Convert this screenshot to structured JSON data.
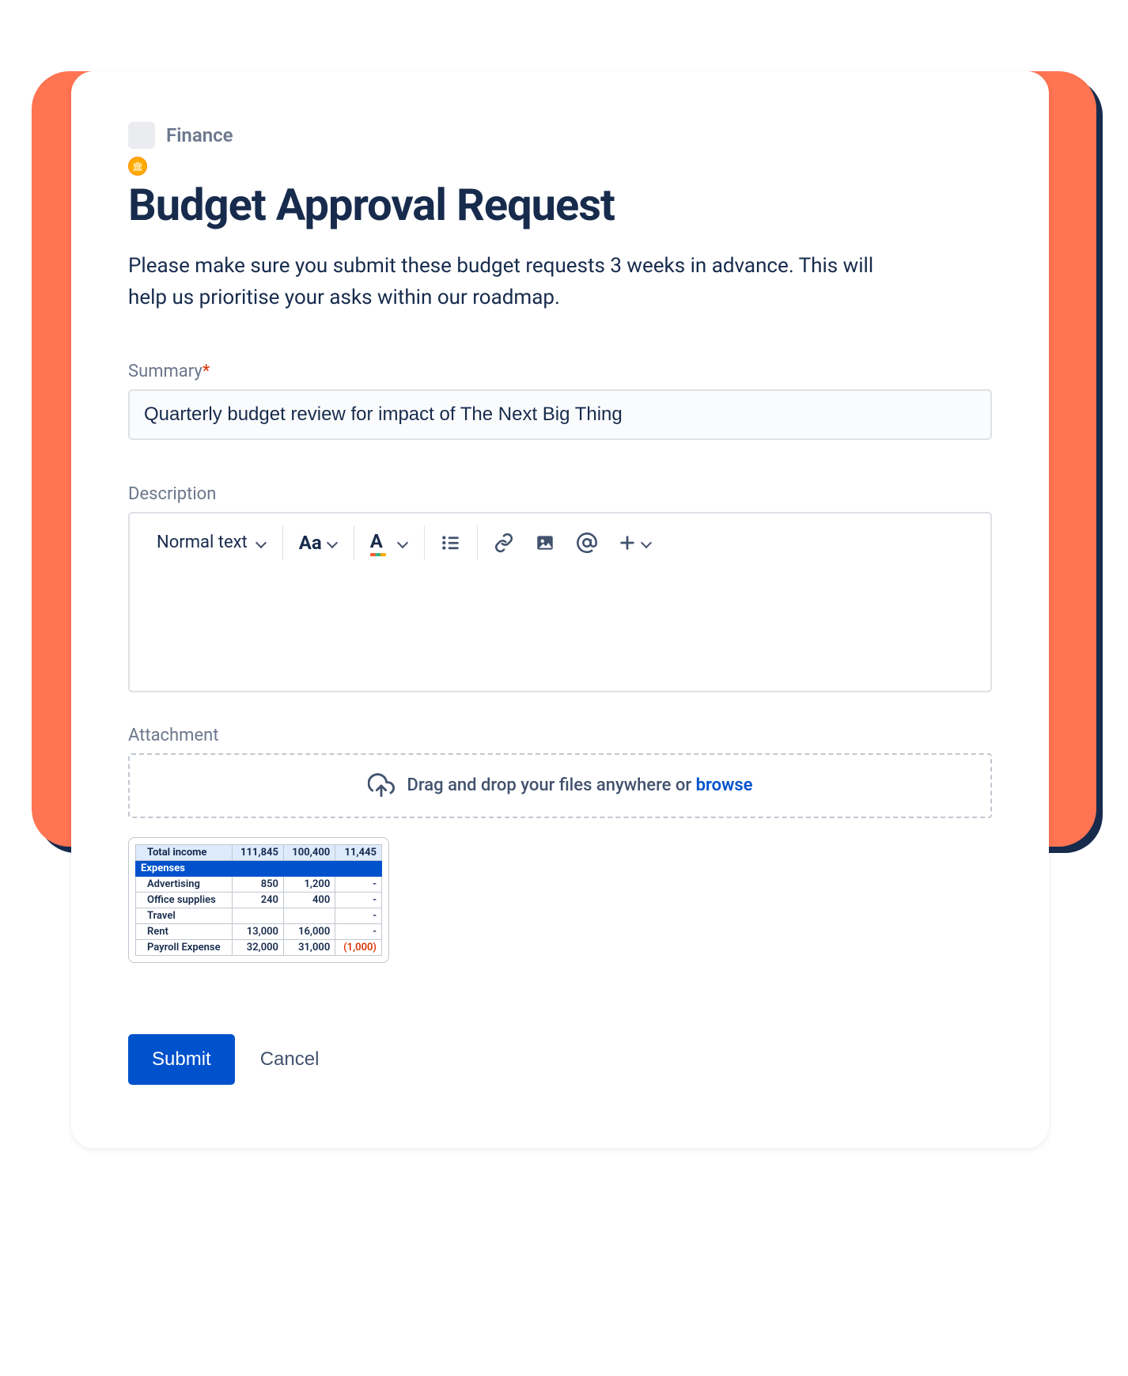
{
  "breadcrumb": {
    "category": "Finance"
  },
  "header": {
    "title": "Budget Approval Request",
    "description": "Please make sure you submit these budget requests 3 weeks in advance. This will help us prioritise your asks within our roadmap."
  },
  "fields": {
    "summary": {
      "label": "Summary",
      "required_marker": "*",
      "value": "Quarterly budget review for impact of The Next Big Thing"
    },
    "description": {
      "label": "Description",
      "toolbar": {
        "text_style_label": "Normal text"
      }
    },
    "attachment": {
      "label": "Attachment",
      "dropzone_text": "Drag and drop your files anywhere or ",
      "browse_label": "browse"
    }
  },
  "attachment_preview": {
    "total_row": {
      "label": "Total income",
      "c1": "111,845",
      "c2": "100,400",
      "c3": "11,445"
    },
    "section_header": "Expenses",
    "rows": [
      {
        "label": "Advertising",
        "c1": "850",
        "c2": "1,200",
        "c3": "-"
      },
      {
        "label": "Office supplies",
        "c1": "240",
        "c2": "400",
        "c3": "-"
      },
      {
        "label": "Travel",
        "c1": "",
        "c2": "",
        "c3": "-"
      },
      {
        "label": "Rent",
        "c1": "13,000",
        "c2": "16,000",
        "c3": "-"
      },
      {
        "label": "Payroll Expense",
        "c1": "32,000",
        "c2": "31,000",
        "c3": "(1,000)"
      }
    ]
  },
  "actions": {
    "submit_label": "Submit",
    "cancel_label": "Cancel"
  }
}
